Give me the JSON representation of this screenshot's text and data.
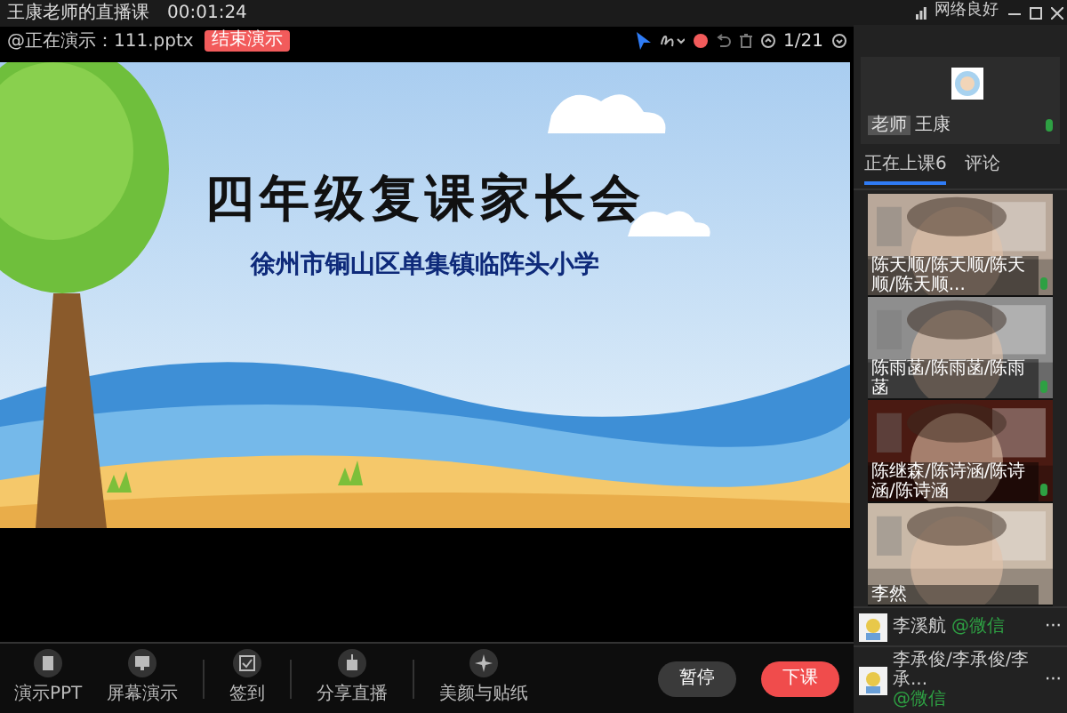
{
  "window": {
    "title": "王康老师的直播课",
    "timer": "00:01:24",
    "network": "网络良好"
  },
  "presenting": {
    "file": "@正在演示：111.pptx",
    "end_button": "结束演示",
    "page": "1/21"
  },
  "slide": {
    "title": "四年级复课家长会",
    "subtitle": "徐州市铜山区单集镇临阵头小学"
  },
  "toolbar": [
    {
      "label": "演示PPT",
      "kind": "doc"
    },
    {
      "label": "屏幕演示",
      "kind": "screen"
    },
    {
      "label": "签到",
      "kind": "check"
    },
    {
      "label": "分享直播",
      "kind": "share"
    },
    {
      "label": "美颜与贴纸",
      "kind": "beauty"
    }
  ],
  "actions": [
    {
      "label": "暂停",
      "kind": "pause"
    },
    {
      "label": "下课",
      "kind": "end"
    }
  ],
  "teacher": {
    "badge": "老师",
    "name": "王康"
  },
  "tabs": [
    {
      "label": "正在上课6",
      "selected": true
    },
    {
      "label": "评论",
      "selected": false
    }
  ],
  "videos": [
    {
      "name": "陈天顺/陈天顺/陈天顺/陈天顺...",
      "mic": true
    },
    {
      "name": "陈雨菡/陈雨菡/陈雨菡",
      "mic": true
    },
    {
      "name": "陈继森/陈诗涵/陈诗涵/陈诗涵",
      "mic": true
    },
    {
      "name": "李然",
      "mic": false
    }
  ],
  "audience": [
    {
      "name": "李溪航",
      "source": "@微信",
      "more": "···"
    },
    {
      "name": "李承俊/李承俊/李承...",
      "source": "@微信",
      "more": "···"
    }
  ]
}
